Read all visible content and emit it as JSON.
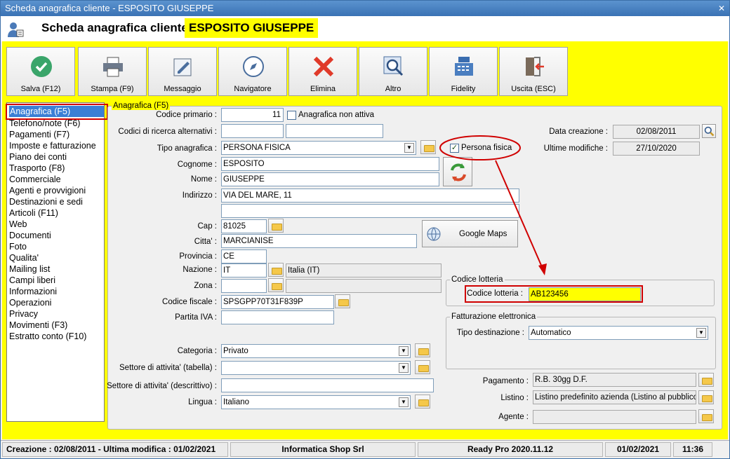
{
  "window": {
    "title": "Scheda anagrafica cliente - ESPOSITO GIUSEPPE",
    "close": "✕"
  },
  "header": {
    "title": "Scheda anagrafica cliente -",
    "name": "ESPOSITO GIUSEPPE"
  },
  "toolbar": [
    {
      "label": "Salva (F12)",
      "icon": "save-check-icon"
    },
    {
      "label": "Stampa (F9)",
      "icon": "printer-icon"
    },
    {
      "label": "Messaggio",
      "icon": "message-icon"
    },
    {
      "label": "Navigatore",
      "icon": "compass-icon"
    },
    {
      "label": "Elimina",
      "icon": "delete-x-icon"
    },
    {
      "label": "Altro",
      "icon": "search-icon"
    },
    {
      "label": "Fidelity",
      "icon": "cash-register-icon"
    },
    {
      "label": "Uscita (ESC)",
      "icon": "exit-door-icon"
    }
  ],
  "nav": {
    "selected": "Anagrafica (F5)",
    "items": [
      "Telefono/note (F6)",
      "Pagamenti (F7)",
      "Imposte e fatturazione",
      "Piano dei conti",
      "Trasporto (F8)",
      "Commerciale",
      "Agenti e provvigioni",
      "Destinazioni e sedi",
      "Articoli (F11)",
      "Web",
      "Documenti",
      "Foto",
      "Qualita'",
      "Mailing list",
      "Campi liberi",
      "Informazioni",
      "Operazioni",
      "Privacy",
      "Movimenti (F3)",
      "Estratto conto (F10)"
    ]
  },
  "form": {
    "group_title": "Anagrafica (F5)",
    "codice_primario_label": "Codice primario :",
    "codice_primario": "11",
    "non_attiva_label": "Anagrafica non attiva",
    "codici_alt_label": "Codici di ricerca alternativi :",
    "tipo_label": "Tipo anagrafica :",
    "tipo": "PERSONA FISICA",
    "persona_fisica_label": "Persona fisica",
    "persona_fisica_checked": true,
    "cognome_label": "Cognome :",
    "cognome": "ESPOSITO",
    "nome_label": "Nome :",
    "nome": "GIUSEPPE",
    "indirizzo_label": "Indirizzo :",
    "indirizzo": "VIA DEL MARE, 11",
    "indirizzo2": "",
    "cap_label": "Cap :",
    "cap": "81025",
    "citta_label": "Citta' :",
    "citta": "MARCIANISE",
    "provincia_label": "Provincia :",
    "provincia": "CE",
    "nazione_label": "Nazione :",
    "nazione": "IT",
    "nazione_desc": "Italia (IT)",
    "zona_label": "Zona :",
    "zona": "",
    "cf_label": "Codice fiscale :",
    "cf": "SPSGPP70T31F839P",
    "piva_label": "Partita IVA :",
    "piva": "",
    "categoria_label": "Categoria :",
    "categoria": "Privato",
    "settore_tab_label": "Settore di attivita' (tabella) :",
    "settore_tab": "",
    "settore_desc_label": "Settore di attivita' (descrittivo) :",
    "settore_desc": "",
    "lingua_label": "Lingua :",
    "lingua": "Italiano",
    "google_maps": "Google Maps",
    "data_creazione_label": "Data creazione :",
    "data_creazione": "02/08/2011",
    "ultime_mod_label": "Ultime modifiche :",
    "ultime_mod": "27/10/2020",
    "lotteria_group": "Codice lotteria",
    "lotteria_label": "Codice lotteria :",
    "lotteria": "AB123456",
    "fe_group": "Fatturazione elettronica",
    "tipo_dest_label": "Tipo destinazione :",
    "tipo_dest": "Automatico",
    "pagamento_label": "Pagamento :",
    "pagamento": "R.B. 30gg D.F.",
    "listino_label": "Listino :",
    "listino": "Listino predefinito azienda (Listino al pubblico)",
    "agente_label": "Agente :",
    "agente": ""
  },
  "status": {
    "creazione": "Creazione : 02/08/2011 - Ultima modifica : 01/02/2021",
    "company": "Informatica Shop Srl",
    "version": "Ready Pro 2020.11.12",
    "date": "01/02/2021",
    "time": "11:36"
  },
  "colors": {
    "highlight": "#ffff00",
    "annotation": "#d00000",
    "selection": "#3a7fd5"
  }
}
